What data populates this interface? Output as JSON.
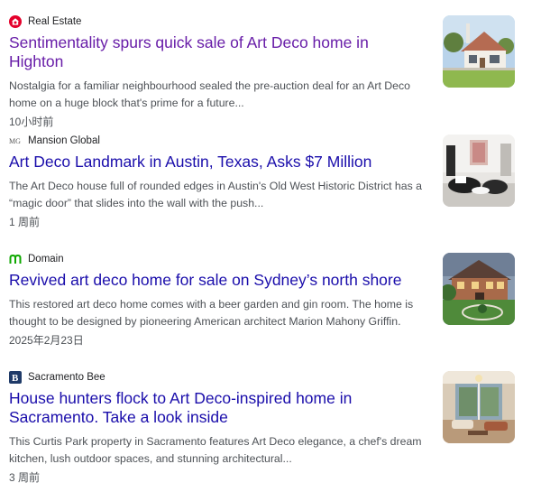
{
  "articles": [
    {
      "source": "Real Estate",
      "logo_icon": "realestate-house-icon",
      "title": "Sentimentality spurs quick sale of Art Deco home in Highton",
      "snippet": "Nostalgia for a familiar neighbourhood sealed the pre-auction deal for an Art Deco home on a huge block that's prime for a future...",
      "time": "10小时前",
      "visited": true,
      "thumbnail": "house-exterior-image"
    },
    {
      "source": "Mansion Global",
      "logo_icon": "mansion-global-logo-icon",
      "title": "Art Deco Landmark in Austin, Texas, Asks $7 Million",
      "snippet": "The Art Deco house full of rounded edges in Austin's Old West Historic District has a “magic door” that slides into the wall with the push...",
      "time": "1 周前",
      "visited": false,
      "thumbnail": "living-room-image"
    },
    {
      "source": "Domain",
      "logo_icon": "domain-logo-icon",
      "title": "Revived art deco home for sale on Sydney’s north shore",
      "snippet": "This restored art deco home comes with a beer garden and gin room. The home is thought to be designed by pioneering American architect Marion Mahony Griffin.",
      "time": "2025年2月23日",
      "visited": false,
      "thumbnail": "mansion-garden-image"
    },
    {
      "source": "Sacramento Bee",
      "logo_icon": "sacramento-bee-logo-icon",
      "title": "House hunters flock to Art Deco-inspired home in Sacramento. Take a look inside",
      "snippet": "This Curtis Park property in Sacramento features Art Deco elegance, a chef's dream kitchen, lush outdoor spaces, and stunning architectural...",
      "time": "3 周前",
      "visited": false,
      "thumbnail": "interior-room-image"
    }
  ],
  "colors": {
    "link": "#1a0dab",
    "visited_link": "#681da8",
    "snippet": "#4d5156",
    "realestate_red": "#e4002b",
    "domain_green": "#0ea800",
    "sacbee_blue": "#1f3a68"
  }
}
